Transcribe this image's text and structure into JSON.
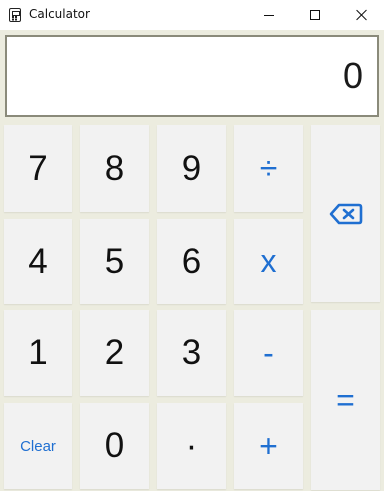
{
  "window": {
    "title": "Calculator"
  },
  "display": {
    "value": "0"
  },
  "keys": {
    "seven": "7",
    "eight": "8",
    "nine": "9",
    "divide": "÷",
    "four": "4",
    "five": "5",
    "six": "6",
    "multiply": "x",
    "one": "1",
    "two": "2",
    "three": "3",
    "minus": "-",
    "clear": "Clear",
    "zero": "0",
    "dot": "·",
    "plus": "+",
    "equals": "="
  },
  "icons": {
    "app": "calculator-icon",
    "backspace": "backspace-icon",
    "minimize": "minimize-icon",
    "maximize": "maximize-icon",
    "close": "close-icon"
  },
  "colors": {
    "accent": "#1f6fd1",
    "key_bg": "#f2f2f2",
    "pad_bg": "#ececdf"
  }
}
